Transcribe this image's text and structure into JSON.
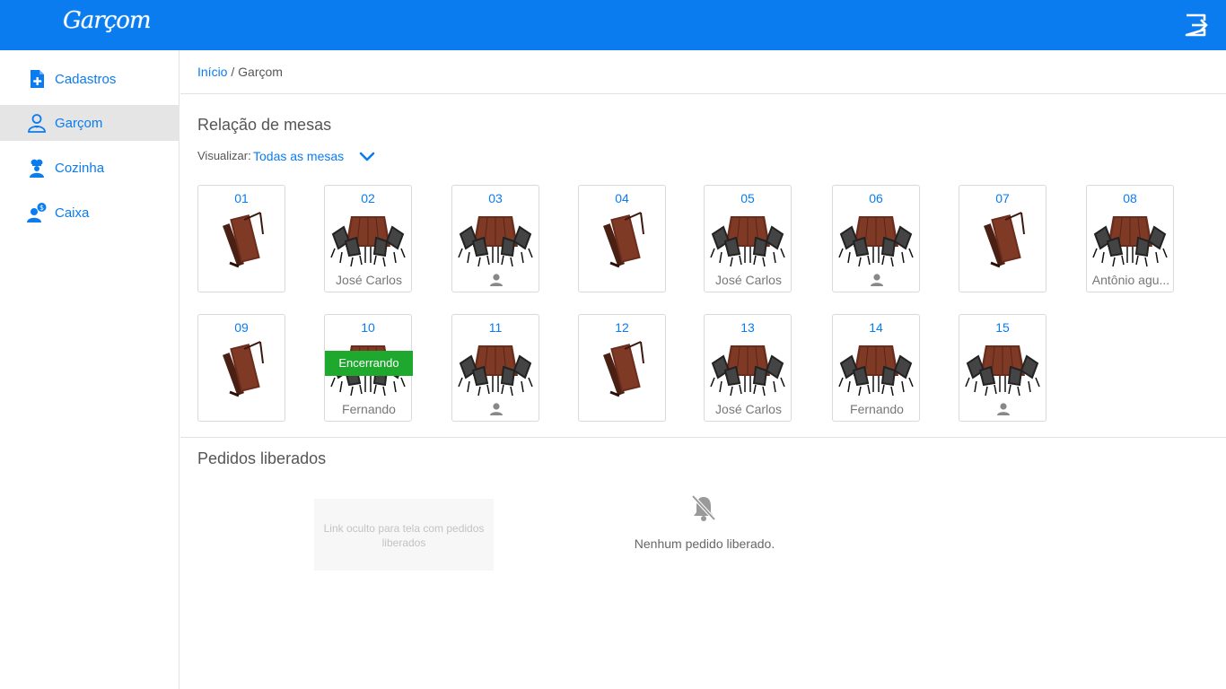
{
  "app": {
    "logo": "Garçom"
  },
  "header": {
    "logout_icon": "logout-icon"
  },
  "sidebar": {
    "items": [
      {
        "label": "Cadastros",
        "icon": "add-file-icon"
      },
      {
        "label": "Garçom",
        "icon": "waiter-icon"
      },
      {
        "label": "Cozinha",
        "icon": "chef-icon"
      },
      {
        "label": "Caixa",
        "icon": "cashier-icon"
      }
    ],
    "active": "Garçom"
  },
  "breadcrumb": {
    "home": "Início",
    "separator": " / ",
    "current": "Garçom"
  },
  "tables_section": {
    "title": "Relação de mesas",
    "filter_label": "Visualizar:",
    "filter_value": "Todas as mesas"
  },
  "tables": [
    {
      "number": "01",
      "state": "folded",
      "waiter": ""
    },
    {
      "number": "02",
      "state": "set",
      "waiter": "José Carlos"
    },
    {
      "number": "03",
      "state": "set",
      "waiter": "",
      "person_icon": true
    },
    {
      "number": "04",
      "state": "folded",
      "waiter": ""
    },
    {
      "number": "05",
      "state": "set",
      "waiter": "José Carlos"
    },
    {
      "number": "06",
      "state": "set",
      "waiter": "",
      "person_icon": true
    },
    {
      "number": "07",
      "state": "folded",
      "waiter": ""
    },
    {
      "number": "08",
      "state": "set",
      "waiter": "Antônio agu..."
    },
    {
      "number": "09",
      "state": "folded",
      "waiter": ""
    },
    {
      "number": "10",
      "state": "set",
      "waiter": "Fernando",
      "badge": "Encerrando"
    },
    {
      "number": "11",
      "state": "set",
      "waiter": "",
      "person_icon": true
    },
    {
      "number": "12",
      "state": "folded",
      "waiter": ""
    },
    {
      "number": "13",
      "state": "set",
      "waiter": "José Carlos"
    },
    {
      "number": "14",
      "state": "set",
      "waiter": "Fernando"
    },
    {
      "number": "15",
      "state": "set",
      "waiter": "",
      "person_icon": true
    }
  ],
  "orders_section": {
    "title": "Pedidos liberados",
    "hidden_link": "Link oculto para tela com pedidos liberados",
    "empty_message": "Nenhum pedido liberado."
  },
  "colors": {
    "primary": "#0a7cf0",
    "success": "#1ea82e",
    "active_bg": "#e5e5e5"
  }
}
